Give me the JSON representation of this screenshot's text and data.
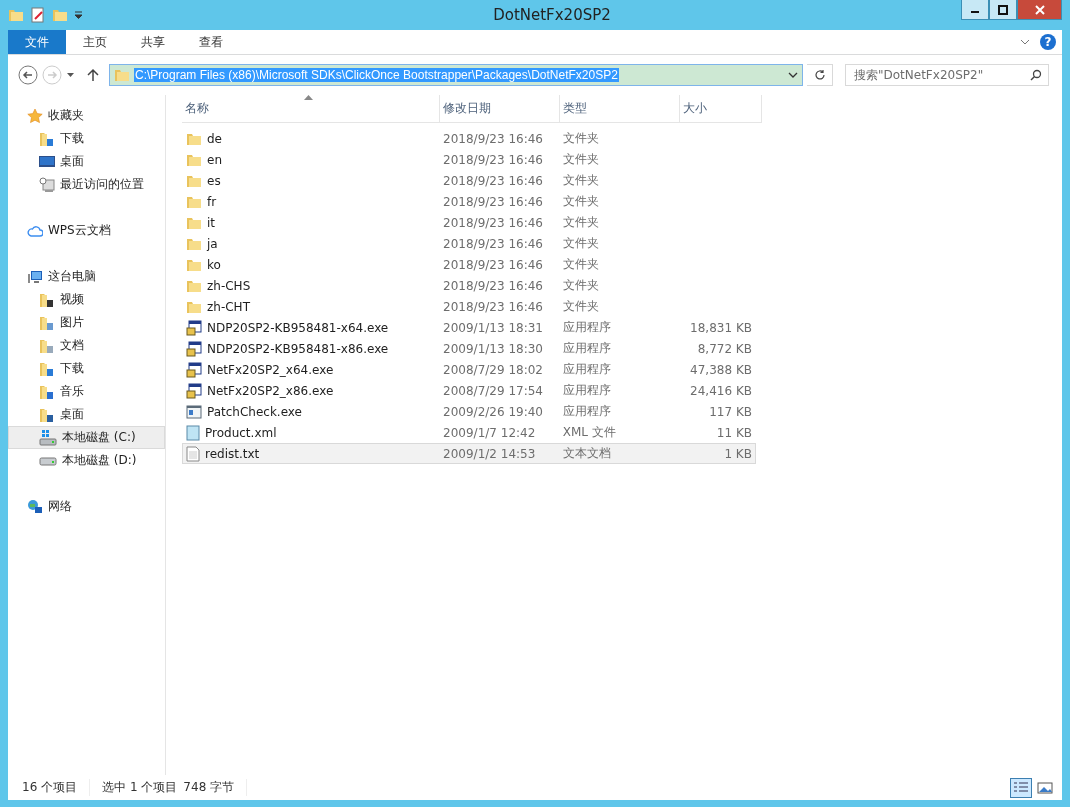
{
  "window": {
    "title": "DotNetFx20SP2"
  },
  "ribbon": {
    "tabs": [
      {
        "label": "文件",
        "kind": "file"
      },
      {
        "label": "主页",
        "kind": "tab"
      },
      {
        "label": "共享",
        "kind": "tab"
      },
      {
        "label": "查看",
        "kind": "tab"
      }
    ],
    "help": "?"
  },
  "address": {
    "path": "C:\\Program Files (x86)\\Microsoft SDKs\\ClickOnce Bootstrapper\\Packages\\DotNetFx20SP2",
    "selected": true,
    "forward_disabled": true
  },
  "search": {
    "placeholder": "搜索\"DotNetFx20SP2\""
  },
  "sidebar": {
    "groups": [
      {
        "label": "收藏夹",
        "kind": "star",
        "children": [
          {
            "label": "下载",
            "kind": "download",
            "selected": false
          },
          {
            "label": "桌面",
            "kind": "desktop",
            "selected": false
          },
          {
            "label": "最近访问的位置",
            "kind": "recent",
            "selected": false
          }
        ]
      },
      {
        "label": "WPS云文档",
        "kind": "cloud"
      },
      {
        "label": "这台电脑",
        "kind": "pc",
        "children": [
          {
            "label": "视频",
            "kind": "video",
            "selected": false
          },
          {
            "label": "图片",
            "kind": "pictures",
            "selected": false
          },
          {
            "label": "文档",
            "kind": "documents",
            "selected": false
          },
          {
            "label": "下载",
            "kind": "download",
            "selected": false
          },
          {
            "label": "音乐",
            "kind": "music",
            "selected": false
          },
          {
            "label": "桌面",
            "kind": "desktopfolder",
            "selected": false
          },
          {
            "label": "本地磁盘 (C:)",
            "kind": "sysdrive",
            "selected": true
          },
          {
            "label": "本地磁盘 (D:)",
            "kind": "drive",
            "selected": false
          }
        ]
      },
      {
        "label": "网络",
        "kind": "network"
      }
    ]
  },
  "table": {
    "columns": [
      "名称",
      "修改日期",
      "类型",
      "大小"
    ],
    "rows": [
      {
        "name": "de",
        "date": "2018/9/23 16:46",
        "type": "文件夹",
        "kind": "folder",
        "selected": false
      },
      {
        "name": "en",
        "date": "2018/9/23 16:46",
        "type": "文件夹",
        "kind": "folder",
        "selected": false
      },
      {
        "name": "es",
        "date": "2018/9/23 16:46",
        "type": "文件夹",
        "kind": "folder",
        "selected": false
      },
      {
        "name": "fr",
        "date": "2018/9/23 16:46",
        "type": "文件夹",
        "kind": "folder",
        "selected": false
      },
      {
        "name": "it",
        "date": "2018/9/23 16:46",
        "type": "文件夹",
        "kind": "folder",
        "selected": false
      },
      {
        "name": "ja",
        "date": "2018/9/23 16:46",
        "type": "文件夹",
        "kind": "folder",
        "selected": false
      },
      {
        "name": "ko",
        "date": "2018/9/23 16:46",
        "type": "文件夹",
        "kind": "folder",
        "selected": false
      },
      {
        "name": "zh-CHS",
        "date": "2018/9/23 16:46",
        "type": "文件夹",
        "kind": "folder",
        "selected": false
      },
      {
        "name": "zh-CHT",
        "date": "2018/9/23 16:46",
        "type": "文件夹",
        "kind": "folder",
        "selected": false
      },
      {
        "name": "NDP20SP2-KB958481-x64.exe",
        "date": "2009/1/13 18:31",
        "type": "应用程序",
        "size": "18,831 KB",
        "kind": "installer",
        "selected": false
      },
      {
        "name": "NDP20SP2-KB958481-x86.exe",
        "date": "2009/1/13 18:30",
        "type": "应用程序",
        "size": "8,772 KB",
        "kind": "installer",
        "selected": false
      },
      {
        "name": "NetFx20SP2_x64.exe",
        "date": "2008/7/29 18:02",
        "type": "应用程序",
        "size": "47,388 KB",
        "kind": "installer",
        "selected": false
      },
      {
        "name": "NetFx20SP2_x86.exe",
        "date": "2008/7/29 17:54",
        "type": "应用程序",
        "size": "24,416 KB",
        "kind": "installer",
        "selected": false
      },
      {
        "name": "PatchCheck.exe",
        "date": "2009/2/26 19:40",
        "type": "应用程序",
        "size": "117 KB",
        "kind": "app",
        "selected": false
      },
      {
        "name": "Product.xml",
        "date": "2009/1/7 12:42",
        "type": "XML 文件",
        "size": "11 KB",
        "kind": "xml",
        "selected": false
      },
      {
        "name": "redist.txt",
        "date": "2009/1/2 14:53",
        "type": "文本文档",
        "size": "1 KB",
        "kind": "text",
        "selected": true
      }
    ]
  },
  "status_bar": {
    "count": "16 个项目",
    "selection": "选中 1 个项目",
    "size": "748 字节",
    "views": [
      {
        "kind": "details",
        "selected": true
      },
      {
        "kind": "large",
        "selected": false
      }
    ]
  }
}
